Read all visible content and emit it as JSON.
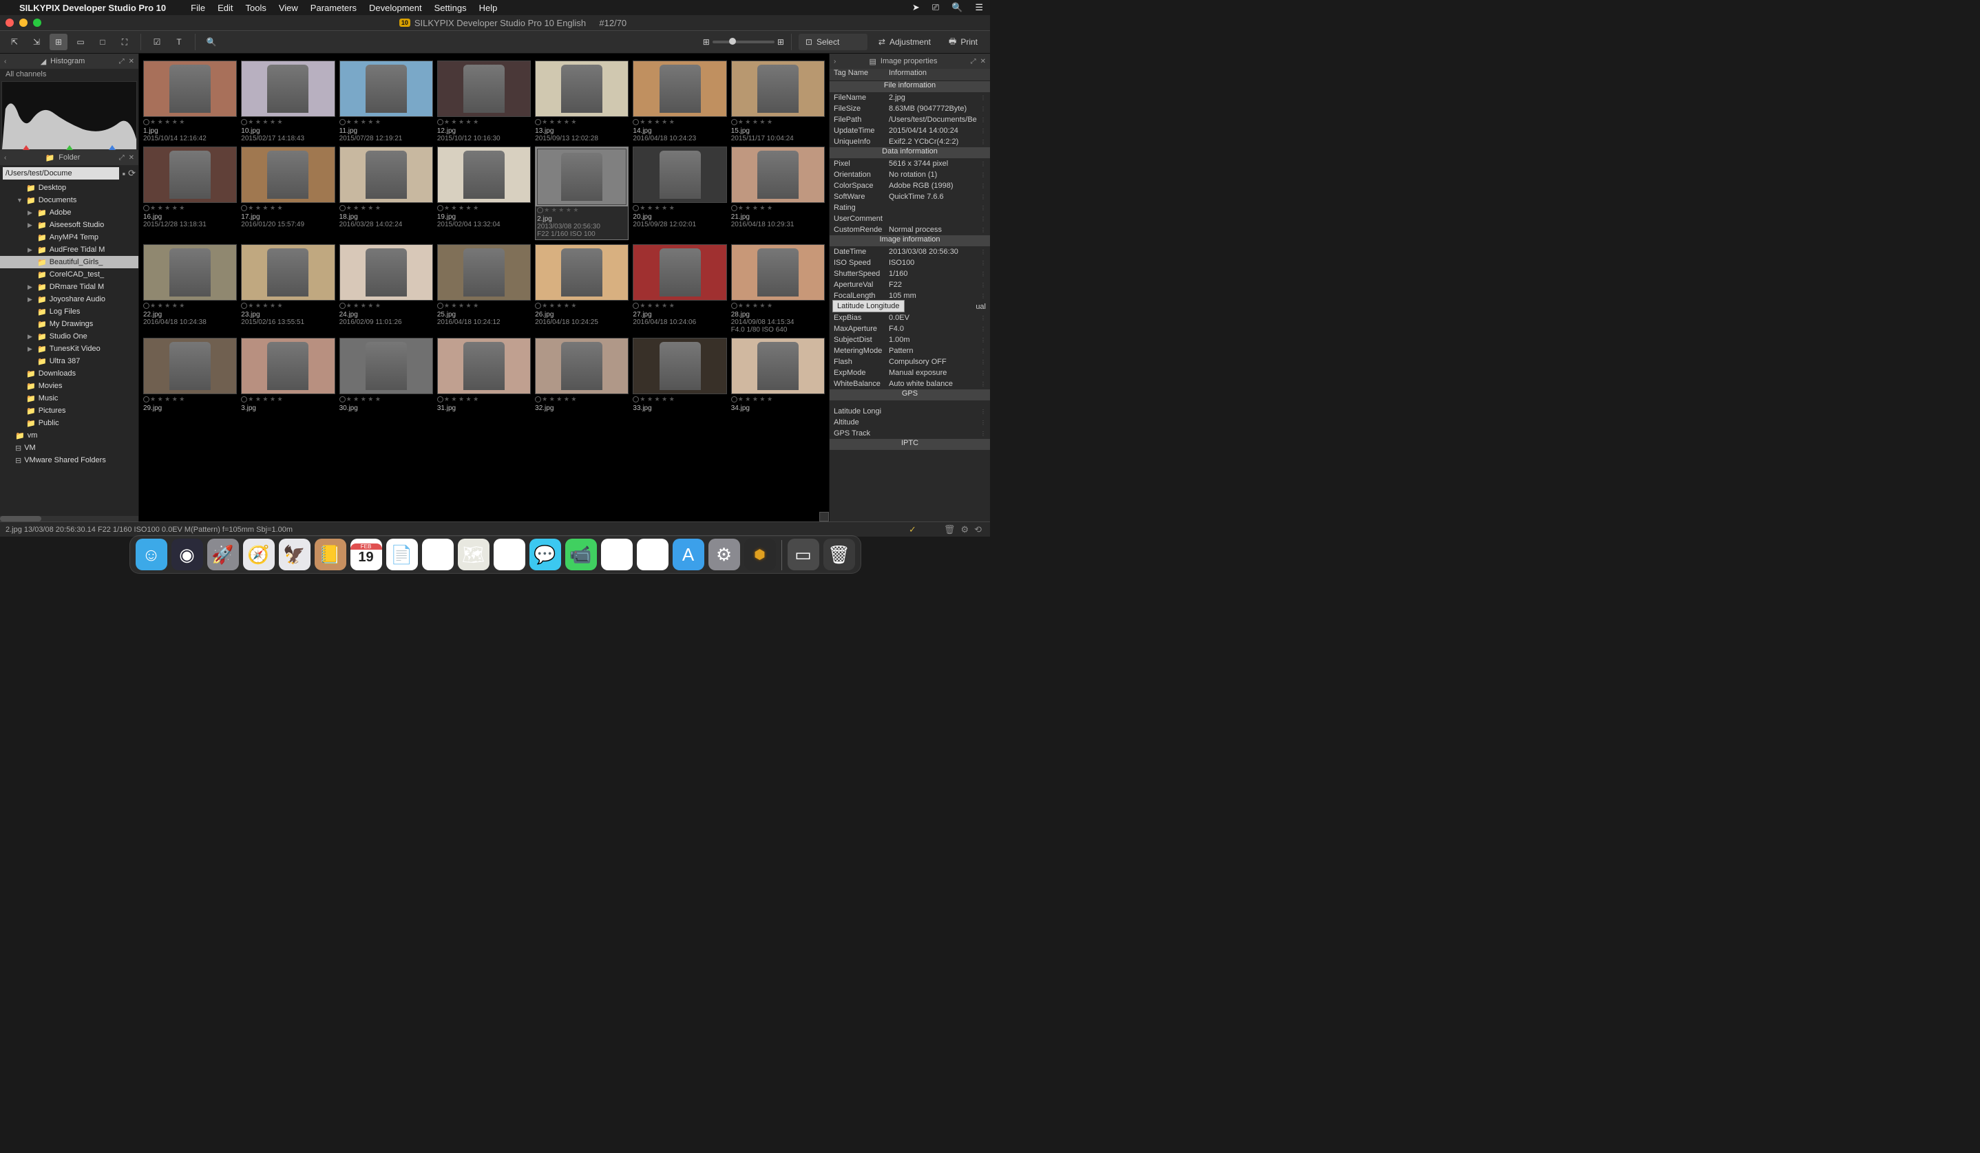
{
  "menubar": {
    "app": "SILKYPIX Developer Studio Pro 10",
    "items": [
      "File",
      "Edit",
      "Tools",
      "View",
      "Parameters",
      "Development",
      "Settings",
      "Help"
    ]
  },
  "titlebar": {
    "badge": "10",
    "title": "SILKYPIX Developer Studio Pro 10 English",
    "counter": "#12/70"
  },
  "toolbar": {
    "select_label": "Select",
    "adjustment_label": "Adjustment",
    "print_label": "Print"
  },
  "left": {
    "histogram_title": "Histogram",
    "channels": "All channels",
    "folder_title": "Folder",
    "path_value": "/Users/test/Docume",
    "tree": [
      {
        "label": "Desktop",
        "depth": 1,
        "arrow": "",
        "icon": "folder"
      },
      {
        "label": "Documents",
        "depth": 1,
        "arrow": "▼",
        "icon": "folder"
      },
      {
        "label": "Adobe",
        "depth": 2,
        "arrow": "▶",
        "icon": "folder"
      },
      {
        "label": "Aiseesoft Studio",
        "depth": 2,
        "arrow": "▶",
        "icon": "folder"
      },
      {
        "label": "AnyMP4 Temp",
        "depth": 2,
        "arrow": "",
        "icon": "folder"
      },
      {
        "label": "AudFree Tidal M",
        "depth": 2,
        "arrow": "▶",
        "icon": "folder"
      },
      {
        "label": "Beautiful_Girls_",
        "depth": 2,
        "arrow": "",
        "icon": "folder",
        "sel": true
      },
      {
        "label": "CorelCAD_test_",
        "depth": 2,
        "arrow": "",
        "icon": "folder"
      },
      {
        "label": "DRmare Tidal M",
        "depth": 2,
        "arrow": "▶",
        "icon": "folder"
      },
      {
        "label": "Joyoshare Audio",
        "depth": 2,
        "arrow": "▶",
        "icon": "folder"
      },
      {
        "label": "Log Files",
        "depth": 2,
        "arrow": "",
        "icon": "folder"
      },
      {
        "label": "My Drawings",
        "depth": 2,
        "arrow": "",
        "icon": "folder"
      },
      {
        "label": "Studio One",
        "depth": 2,
        "arrow": "▶",
        "icon": "folder"
      },
      {
        "label": "TunesKit Video",
        "depth": 2,
        "arrow": "▶",
        "icon": "folder"
      },
      {
        "label": "Ultra 387",
        "depth": 2,
        "arrow": "",
        "icon": "folder"
      },
      {
        "label": "Downloads",
        "depth": 1,
        "arrow": "",
        "icon": "folder"
      },
      {
        "label": "Movies",
        "depth": 1,
        "arrow": "",
        "icon": "folder"
      },
      {
        "label": "Music",
        "depth": 1,
        "arrow": "",
        "icon": "folder"
      },
      {
        "label": "Pictures",
        "depth": 1,
        "arrow": "",
        "icon": "folder"
      },
      {
        "label": "Public",
        "depth": 1,
        "arrow": "",
        "icon": "folder"
      },
      {
        "label": "vm",
        "depth": 0,
        "arrow": "",
        "icon": "folder"
      },
      {
        "label": "VM",
        "depth": 0,
        "arrow": "",
        "icon": "disk",
        "disk": true
      },
      {
        "label": "VMware Shared Folders",
        "depth": 0,
        "arrow": "",
        "icon": "disk",
        "disk": true
      }
    ]
  },
  "thumbs": [
    {
      "fn": "1.jpg",
      "dt": "2015/10/14 12:16:42",
      "bg": "#a8705a"
    },
    {
      "fn": "10.jpg",
      "dt": "2015/02/17 14:18:43",
      "bg": "#b8b0c0"
    },
    {
      "fn": "11.jpg",
      "dt": "2015/07/28 12:19:21",
      "bg": "#7aa8c8"
    },
    {
      "fn": "12.jpg",
      "dt": "2015/10/12 10:16:30",
      "bg": "#4a3838"
    },
    {
      "fn": "13.jpg",
      "dt": "2015/09/13 12:02:28",
      "bg": "#d0c8b0"
    },
    {
      "fn": "14.jpg",
      "dt": "2016/04/18 10:24:23",
      "bg": "#c09060"
    },
    {
      "fn": "15.jpg",
      "dt": "2015/11/17 10:04:24",
      "bg": "#b89870"
    },
    {
      "fn": "16.jpg",
      "dt": "2015/12/28 13:18:31",
      "bg": "#604038"
    },
    {
      "fn": "17.jpg",
      "dt": "2016/01/20 15:57:49",
      "bg": "#a07850"
    },
    {
      "fn": "18.jpg",
      "dt": "2016/03/28 14:02:24",
      "bg": "#c8b8a0"
    },
    {
      "fn": "19.jpg",
      "dt": "2015/02/04 13:32:04",
      "bg": "#d8d0c0"
    },
    {
      "fn": "2.jpg",
      "dt": "2013/03/08 20:56:30",
      "extra": "F22 1/160 ISO 100",
      "bg": "#808080",
      "sel": true,
      "bw": true
    },
    {
      "fn": "20.jpg",
      "dt": "2015/09/28 12:02:01",
      "bg": "#383838"
    },
    {
      "fn": "21.jpg",
      "dt": "2016/04/18 10:29:31",
      "bg": "#c09880"
    },
    {
      "fn": "22.jpg",
      "dt": "2016/04/18 10:24:38",
      "bg": "#908870"
    },
    {
      "fn": "23.jpg",
      "dt": "2015/02/16 13:55:51",
      "bg": "#c0a880"
    },
    {
      "fn": "24.jpg",
      "dt": "2016/02/09 11:01:26",
      "bg": "#d8c8b8"
    },
    {
      "fn": "25.jpg",
      "dt": "2016/04/18 10:24:12",
      "bg": "#807058"
    },
    {
      "fn": "26.jpg",
      "dt": "2016/04/18 10:24:25",
      "bg": "#d8b080"
    },
    {
      "fn": "27.jpg",
      "dt": "2016/04/18 10:24:06",
      "bg": "#a03030"
    },
    {
      "fn": "28.jpg",
      "dt": "2014/09/08 14:15:34",
      "extra": "F4.0 1/80 ISO 640",
      "bg": "#c89878"
    },
    {
      "fn": "29.jpg",
      "dt": "",
      "bg": "#706050"
    },
    {
      "fn": "3.jpg",
      "dt": "",
      "bg": "#b89080"
    },
    {
      "fn": "30.jpg",
      "dt": "",
      "bg": "#707070",
      "bw": true
    },
    {
      "fn": "31.jpg",
      "dt": "",
      "bg": "#c0a090"
    },
    {
      "fn": "32.jpg",
      "dt": "",
      "bg": "#b09888"
    },
    {
      "fn": "33.jpg",
      "dt": "",
      "bg": "#383028"
    },
    {
      "fn": "34.jpg",
      "dt": "",
      "bg": "#d0b8a0"
    }
  ],
  "right": {
    "title": "Image properties",
    "hdr_tag": "Tag Name",
    "hdr_info": "Information",
    "sections": {
      "file": "File information",
      "data": "Data information",
      "image": "Image information",
      "gps": "GPS",
      "iptc": "IPTC"
    },
    "file_rows": [
      {
        "k": "FileName",
        "v": "2.jpg"
      },
      {
        "k": "FileSize",
        "v": "8.63MB (9047772Byte)"
      },
      {
        "k": "FilePath",
        "v": "/Users/test/Documents/Be"
      },
      {
        "k": "UpdateTime",
        "v": "2015/04/14 14:00:24"
      },
      {
        "k": "UniqueInfo",
        "v": "Exif2.2 YCbCr(4:2:2)"
      }
    ],
    "data_rows": [
      {
        "k": "Pixel",
        "v": "5616 x 3744 pixel"
      },
      {
        "k": "Orientation",
        "v": "No rotation (1)"
      },
      {
        "k": "ColorSpace",
        "v": "Adobe RGB (1998)"
      },
      {
        "k": "SoftWare",
        "v": "QuickTime 7.6.6"
      },
      {
        "k": "Rating",
        "v": ""
      },
      {
        "k": "UserComment",
        "v": ""
      },
      {
        "k": "CustomRende",
        "v": "Normal process"
      }
    ],
    "image_rows": [
      {
        "k": "DateTime",
        "v": "2013/03/08 20:56:30"
      },
      {
        "k": "ISO Speed",
        "v": "ISO100"
      },
      {
        "k": "ShutterSpeed",
        "v": "1/160"
      },
      {
        "k": "ApertureVal",
        "v": "F22"
      },
      {
        "k": "FocalLength",
        "v": "105 mm"
      },
      {
        "k": "",
        "v": "ual",
        "tooltip": "Latitude Longitude"
      },
      {
        "k": "ExpBias",
        "v": "0.0EV"
      },
      {
        "k": "MaxAperture",
        "v": "F4.0"
      },
      {
        "k": "SubjectDist",
        "v": "1.00m"
      },
      {
        "k": "MeteringMode",
        "v": "Pattern"
      },
      {
        "k": "Flash",
        "v": "Compulsory OFF"
      },
      {
        "k": "ExpMode",
        "v": "Manual exposure"
      },
      {
        "k": "WhiteBalance",
        "v": "Auto white balance"
      }
    ],
    "gps_rows": [
      {
        "k": "Latitude Longi",
        "v": ""
      },
      {
        "k": "Altitude",
        "v": ""
      },
      {
        "k": "GPS Track",
        "v": ""
      }
    ]
  },
  "status": {
    "text": "2.jpg 13/03/08 20:56:30.14 F22 1/160 ISO100  0.0EV M(Pattern) f=105mm Sbj=1.00m",
    "tags": [
      "#d4b050",
      "#d07050",
      "#d05050",
      "#5090d0",
      "#50b050",
      "#9050d0",
      "#d050a0",
      "#707070"
    ]
  },
  "dock": [
    {
      "name": "finder",
      "bg": "#3ca9e8",
      "glyph": "☺"
    },
    {
      "name": "siri",
      "bg": "#2a2a3a",
      "glyph": "◉"
    },
    {
      "name": "launchpad",
      "bg": "#8a8a90",
      "glyph": "🚀"
    },
    {
      "name": "safari",
      "bg": "#e8e8ec",
      "glyph": "🧭"
    },
    {
      "name": "preview",
      "bg": "#e8e8ec",
      "glyph": "🦅"
    },
    {
      "name": "contacts",
      "bg": "#c89060",
      "glyph": "📒"
    },
    {
      "name": "calendar",
      "bg": "#ffffff",
      "glyph": "19",
      "cal": true
    },
    {
      "name": "notes",
      "bg": "#ffffff",
      "glyph": "📄"
    },
    {
      "name": "reminders",
      "bg": "#ffffff",
      "glyph": "☰"
    },
    {
      "name": "maps",
      "bg": "#e8e8e0",
      "glyph": "🗺"
    },
    {
      "name": "photos",
      "bg": "#ffffff",
      "glyph": "✿"
    },
    {
      "name": "messages",
      "bg": "#3cc8f0",
      "glyph": "💬"
    },
    {
      "name": "facetime",
      "bg": "#40d060",
      "glyph": "📹"
    },
    {
      "name": "news",
      "bg": "#ffffff",
      "glyph": "N"
    },
    {
      "name": "music",
      "bg": "#ffffff",
      "glyph": "♫"
    },
    {
      "name": "appstore",
      "bg": "#3ca0ea",
      "glyph": "A"
    },
    {
      "name": "settings",
      "bg": "#8a8a90",
      "glyph": "⚙"
    },
    {
      "name": "silkypix",
      "bg": "#2a2a2a",
      "glyph": "10",
      "gold": true
    },
    {
      "sep": true
    },
    {
      "name": "download",
      "bg": "#4a4a4a",
      "glyph": "▭"
    },
    {
      "name": "trash",
      "bg": "#3a3a3a",
      "glyph": "🗑"
    }
  ]
}
